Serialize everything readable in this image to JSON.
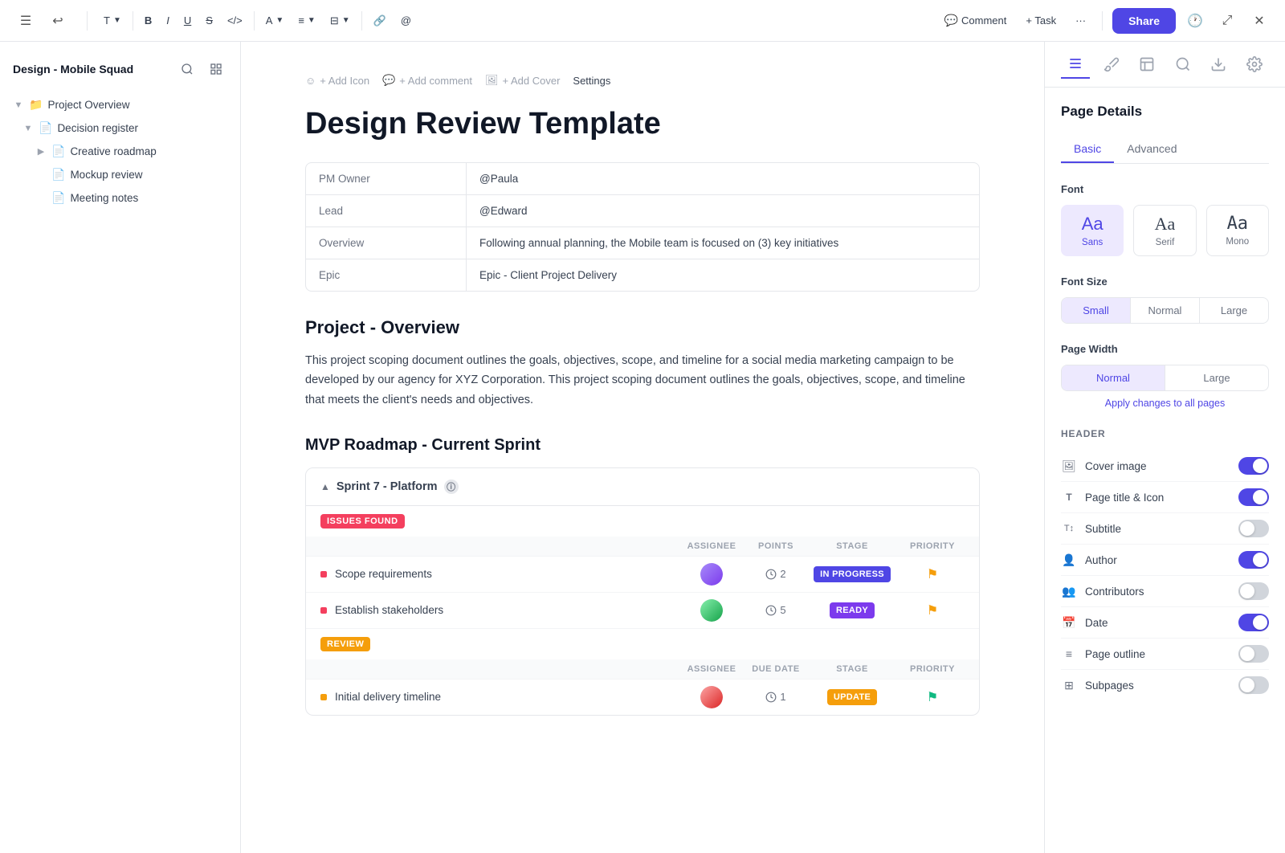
{
  "toolbar": {
    "menu_icon": "☰",
    "undo_icon": "↩",
    "text_label": "T",
    "bold_label": "B",
    "italic_label": "I",
    "underline_label": "U",
    "strikethrough_label": "S",
    "code_label": "</>",
    "font_color_label": "A",
    "align_label": "≡",
    "list_label": "⊟",
    "link_label": "🔗",
    "at_label": "@",
    "comment_label": "Comment",
    "task_label": "+ Task",
    "more_label": "···",
    "share_label": "Share",
    "history_icon": "🕐",
    "expand_icon": "⤢",
    "close_icon": "✕"
  },
  "sidebar": {
    "title": "Design - Mobile Squad",
    "search_icon": "🔍",
    "layout_icon": "▣",
    "items": [
      {
        "label": "Project Overview",
        "indent": 0,
        "has_chevron": true,
        "expanded": true,
        "icon": "📁"
      },
      {
        "label": "Decision register",
        "indent": 1,
        "has_chevron": true,
        "expanded": true,
        "icon": "📄"
      },
      {
        "label": "Creative roadmap",
        "indent": 2,
        "has_chevron": true,
        "expanded": false,
        "icon": "📄"
      },
      {
        "label": "Mockup review",
        "indent": 2,
        "has_chevron": false,
        "expanded": false,
        "icon": "📄"
      },
      {
        "label": "Meeting notes",
        "indent": 2,
        "has_chevron": false,
        "expanded": false,
        "icon": "📄"
      }
    ]
  },
  "page": {
    "actions": {
      "add_icon": "+ Add Icon",
      "add_comment": "+ Add comment",
      "add_cover": "+ Add Cover",
      "settings": "Settings"
    },
    "title": "Design Review Template",
    "info_table": [
      {
        "label": "PM Owner",
        "value": "@Paula"
      },
      {
        "label": "Lead",
        "value": "@Edward"
      },
      {
        "label": "Overview",
        "value": "Following annual planning, the Mobile team is focused on (3) key initiatives"
      },
      {
        "label": "Epic",
        "value": "Epic - Client Project Delivery"
      }
    ],
    "section1": {
      "heading": "Project - Overview",
      "body": "This project scoping document outlines the goals, objectives, scope, and timeline for a social media marketing campaign to be developed by our agency for XYZ Corporation. This project scoping document outlines the goals, objectives, scope, and timeline that meets the client's needs and objectives."
    },
    "section2": {
      "heading": "MVP Roadmap - Current Sprint",
      "sprint": {
        "title": "Sprint  7 - Platform",
        "groups": [
          {
            "badge": "ISSUES FOUND",
            "badge_type": "issues",
            "columns": [
              "ASSIGNEE",
              "POINTS",
              "STAGE",
              "PRIORITY"
            ],
            "rows": [
              {
                "name": "Scope requirements",
                "indicator_color": "#f43f5e",
                "points": 2,
                "stage": "IN PROGRESS",
                "stage_type": "in-progress",
                "priority": "yellow"
              },
              {
                "name": "Establish stakeholders",
                "indicator_color": "#f43f5e",
                "points": 5,
                "stage": "READY",
                "stage_type": "ready",
                "priority": "yellow"
              }
            ]
          },
          {
            "badge": "REVIEW",
            "badge_type": "review",
            "columns": [
              "ASSIGNEE",
              "DUE DATE",
              "STAGE",
              "PRIORITY"
            ],
            "rows": [
              {
                "name": "Initial delivery timeline",
                "indicator_color": "#f59e0b",
                "points": 1,
                "stage": "UPDATE",
                "stage_type": "update",
                "priority": "green"
              }
            ]
          }
        ]
      }
    }
  },
  "right_panel": {
    "section_title": "Page Details",
    "sub_tabs": [
      {
        "label": "Basic",
        "active": true
      },
      {
        "label": "Advanced",
        "active": false
      }
    ],
    "font_section": {
      "label": "Font",
      "options": [
        {
          "label": "Sans",
          "sample": "Aa",
          "active": true
        },
        {
          "label": "Serif",
          "sample": "Aa",
          "active": false
        },
        {
          "label": "Mono",
          "sample": "Aa",
          "active": false
        }
      ]
    },
    "font_size_section": {
      "label": "Font Size",
      "options": [
        {
          "label": "Small",
          "active": true
        },
        {
          "label": "Normal",
          "active": false
        },
        {
          "label": "Large",
          "active": false
        }
      ]
    },
    "page_width_section": {
      "label": "Page Width",
      "options": [
        {
          "label": "Normal",
          "active": true
        },
        {
          "label": "Large",
          "active": false
        }
      ],
      "apply_link": "Apply changes to all pages"
    },
    "header_section": {
      "label": "HEADER",
      "items": [
        {
          "label": "Cover image",
          "icon": "🖼",
          "toggle": true
        },
        {
          "label": "Page title & Icon",
          "icon": "T",
          "toggle": true
        },
        {
          "label": "Subtitle",
          "icon": "T",
          "toggle": false
        },
        {
          "label": "Author",
          "icon": "👤",
          "toggle": true
        },
        {
          "label": "Contributors",
          "icon": "👥",
          "toggle": false
        },
        {
          "label": "Date",
          "icon": "📅",
          "toggle": true
        },
        {
          "label": "Page outline",
          "icon": "≡",
          "toggle": false
        },
        {
          "label": "Subpages",
          "icon": "⊞",
          "toggle": false
        }
      ]
    }
  }
}
